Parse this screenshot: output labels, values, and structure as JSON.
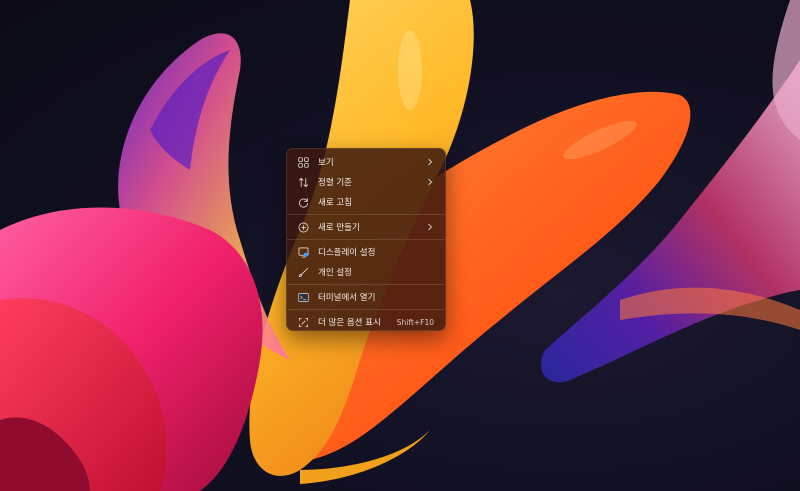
{
  "context_menu": {
    "items": [
      {
        "label": "보기",
        "icon": "view-grid-icon",
        "submenu": true
      },
      {
        "label": "정렬 기준",
        "icon": "sort-icon",
        "submenu": true
      },
      {
        "label": "새로 고침",
        "icon": "refresh-icon",
        "submenu": false
      },
      {
        "label": "새로 만들기",
        "icon": "new-plus-icon",
        "submenu": true
      },
      {
        "label": "디스플레이 설정",
        "icon": "display-settings-icon",
        "submenu": false
      },
      {
        "label": "개인 설정",
        "icon": "personalize-brush-icon",
        "submenu": false
      },
      {
        "label": "터미널에서 열기",
        "icon": "terminal-icon",
        "submenu": false
      },
      {
        "label": "더 많은 옵션 표시",
        "icon": "more-options-icon",
        "submenu": false,
        "shortcut": "Shift+F10"
      }
    ]
  },
  "colors": {
    "menu_background": "#3c180e",
    "menu_text": "#f3ece8",
    "desktop_background": "#100f20"
  }
}
